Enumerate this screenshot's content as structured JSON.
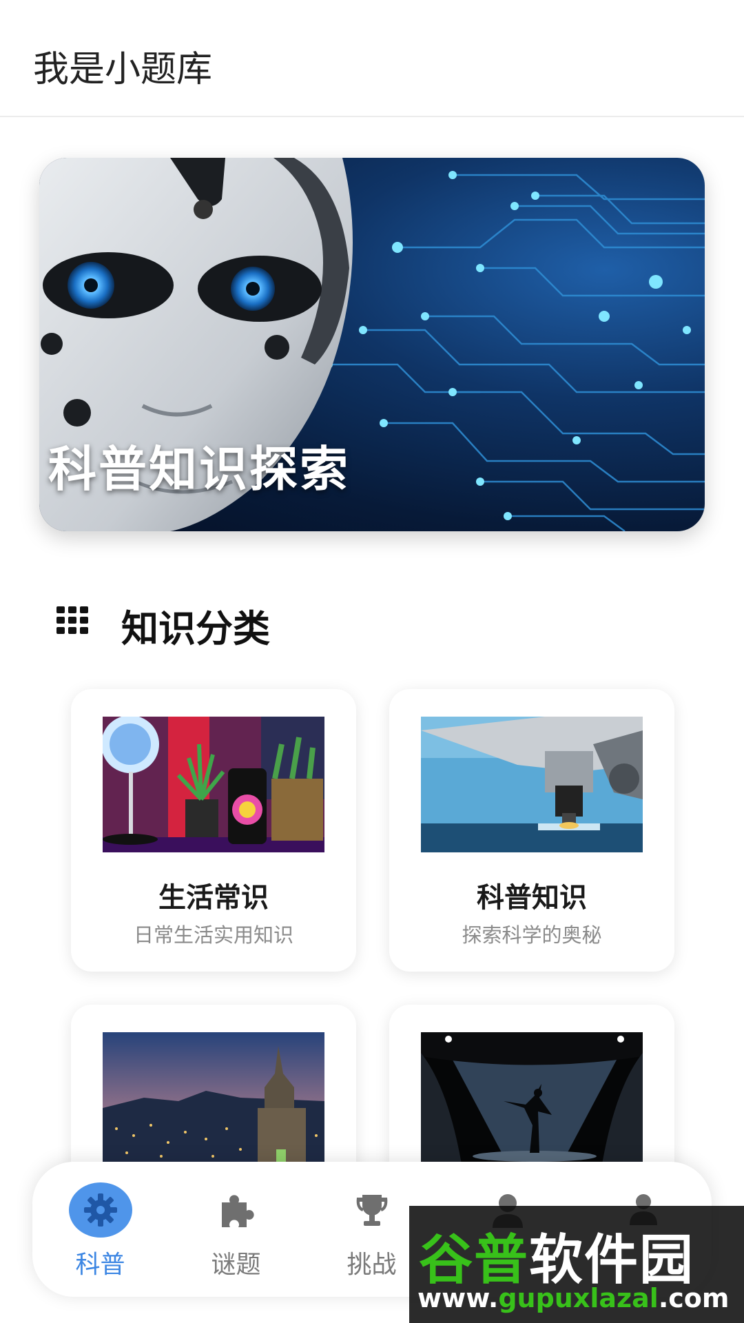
{
  "header": {
    "title": "我是小题库"
  },
  "banner": {
    "title": "科普知识探索"
  },
  "section": {
    "title": "知识分类"
  },
  "categories": [
    {
      "title": "生活常识",
      "subtitle": "日常生活实用知识",
      "image": "smart-lamp-photo"
    },
    {
      "title": "科普知识",
      "subtitle": "探索科学的奥秘",
      "image": "microscope-photo"
    },
    {
      "title": "",
      "subtitle": "",
      "image": "night-city-photo"
    },
    {
      "title": "",
      "subtitle": "",
      "image": "ballet-stage-photo"
    }
  ],
  "nav": {
    "items": [
      {
        "label": "科普",
        "icon": "gear-icon",
        "active": true
      },
      {
        "label": "谜题",
        "icon": "puzzle-icon",
        "active": false
      },
      {
        "label": "挑战",
        "icon": "trophy-icon",
        "active": false
      },
      {
        "label": "",
        "icon": "user-icon",
        "active": false
      },
      {
        "label": "",
        "icon": "profile-icon",
        "active": false
      }
    ],
    "active_color": "#4f95ea"
  },
  "watermark": {
    "brand_part1": "谷普",
    "brand_part2": "软件园",
    "url_part1": "www.",
    "url_part2": "gupuxlazal",
    "url_part3": ".com"
  }
}
